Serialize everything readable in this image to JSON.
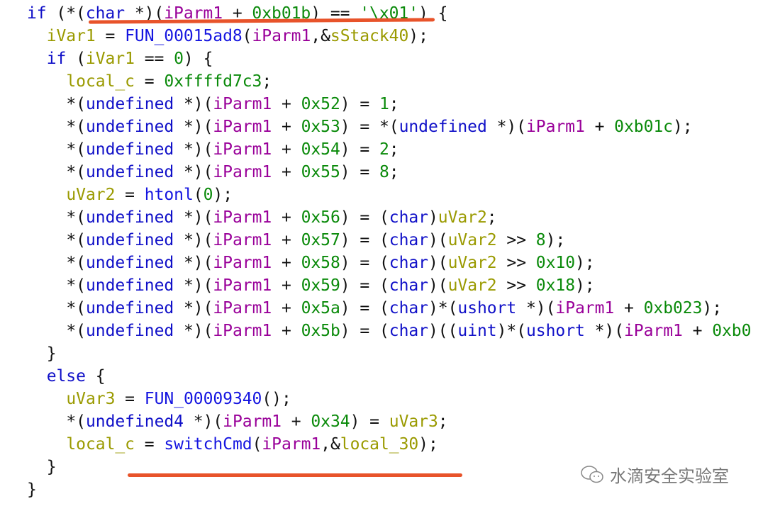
{
  "code_lines": [
    {
      "indent": 0,
      "tokens": [
        [
          "if",
          "kw"
        ],
        [
          " (*(",
          "op"
        ],
        [
          "char",
          "kw"
        ],
        [
          " *)(",
          "op"
        ],
        [
          "iParm1",
          "pa"
        ],
        [
          " + ",
          "op"
        ],
        [
          "0xb01b",
          "nu"
        ],
        [
          ") == ",
          "op"
        ],
        [
          "'\\x01'",
          "nu"
        ],
        [
          ") {",
          "op"
        ]
      ]
    },
    {
      "indent": 1,
      "tokens": [
        [
          "iVar1",
          "va"
        ],
        [
          " = ",
          "op"
        ],
        [
          "FUN_00015ad8",
          "fn"
        ],
        [
          "(",
          "op"
        ],
        [
          "iParm1",
          "pa"
        ],
        [
          ",&",
          "op"
        ],
        [
          "sStack40",
          "va"
        ],
        [
          ");",
          "op"
        ]
      ]
    },
    {
      "indent": 1,
      "tokens": [
        [
          "if",
          "kw"
        ],
        [
          " (",
          "op"
        ],
        [
          "iVar1",
          "va"
        ],
        [
          " == ",
          "op"
        ],
        [
          "0",
          "nu"
        ],
        [
          ") {",
          "op"
        ]
      ]
    },
    {
      "indent": 2,
      "tokens": [
        [
          "local_c",
          "va"
        ],
        [
          " = ",
          "op"
        ],
        [
          "0xffffd7c3",
          "nu"
        ],
        [
          ";",
          "op"
        ]
      ]
    },
    {
      "indent": 2,
      "tokens": [
        [
          "*(",
          "op"
        ],
        [
          "undefined",
          "kw"
        ],
        [
          " *)(",
          "op"
        ],
        [
          "iParm1",
          "pa"
        ],
        [
          " + ",
          "op"
        ],
        [
          "0x52",
          "nu"
        ],
        [
          ") = ",
          "op"
        ],
        [
          "1",
          "nu"
        ],
        [
          ";",
          "op"
        ]
      ]
    },
    {
      "indent": 2,
      "tokens": [
        [
          "*(",
          "op"
        ],
        [
          "undefined",
          "kw"
        ],
        [
          " *)(",
          "op"
        ],
        [
          "iParm1",
          "pa"
        ],
        [
          " + ",
          "op"
        ],
        [
          "0x53",
          "nu"
        ],
        [
          ") = *(",
          "op"
        ],
        [
          "undefined",
          "kw"
        ],
        [
          " *)(",
          "op"
        ],
        [
          "iParm1",
          "pa"
        ],
        [
          " + ",
          "op"
        ],
        [
          "0xb01c",
          "nu"
        ],
        [
          ");",
          "op"
        ]
      ]
    },
    {
      "indent": 2,
      "tokens": [
        [
          "*(",
          "op"
        ],
        [
          "undefined",
          "kw"
        ],
        [
          " *)(",
          "op"
        ],
        [
          "iParm1",
          "pa"
        ],
        [
          " + ",
          "op"
        ],
        [
          "0x54",
          "nu"
        ],
        [
          ") = ",
          "op"
        ],
        [
          "2",
          "nu"
        ],
        [
          ";",
          "op"
        ]
      ]
    },
    {
      "indent": 2,
      "tokens": [
        [
          "*(",
          "op"
        ],
        [
          "undefined",
          "kw"
        ],
        [
          " *)(",
          "op"
        ],
        [
          "iParm1",
          "pa"
        ],
        [
          " + ",
          "op"
        ],
        [
          "0x55",
          "nu"
        ],
        [
          ") = ",
          "op"
        ],
        [
          "8",
          "nu"
        ],
        [
          ";",
          "op"
        ]
      ]
    },
    {
      "indent": 2,
      "tokens": [
        [
          "uVar2",
          "va"
        ],
        [
          " = ",
          "op"
        ],
        [
          "htonl",
          "fn"
        ],
        [
          "(",
          "op"
        ],
        [
          "0",
          "nu"
        ],
        [
          ");",
          "op"
        ]
      ]
    },
    {
      "indent": 2,
      "tokens": [
        [
          "*(",
          "op"
        ],
        [
          "undefined",
          "kw"
        ],
        [
          " *)(",
          "op"
        ],
        [
          "iParm1",
          "pa"
        ],
        [
          " + ",
          "op"
        ],
        [
          "0x56",
          "nu"
        ],
        [
          ") = (",
          "op"
        ],
        [
          "char",
          "kw"
        ],
        [
          ")",
          "op"
        ],
        [
          "uVar2",
          "va"
        ],
        [
          ";",
          "op"
        ]
      ]
    },
    {
      "indent": 2,
      "tokens": [
        [
          "*(",
          "op"
        ],
        [
          "undefined",
          "kw"
        ],
        [
          " *)(",
          "op"
        ],
        [
          "iParm1",
          "pa"
        ],
        [
          " + ",
          "op"
        ],
        [
          "0x57",
          "nu"
        ],
        [
          ") = (",
          "op"
        ],
        [
          "char",
          "kw"
        ],
        [
          ")(",
          "op"
        ],
        [
          "uVar2",
          "va"
        ],
        [
          " >> ",
          "op"
        ],
        [
          "8",
          "nu"
        ],
        [
          ");",
          "op"
        ]
      ]
    },
    {
      "indent": 2,
      "tokens": [
        [
          "*(",
          "op"
        ],
        [
          "undefined",
          "kw"
        ],
        [
          " *)(",
          "op"
        ],
        [
          "iParm1",
          "pa"
        ],
        [
          " + ",
          "op"
        ],
        [
          "0x58",
          "nu"
        ],
        [
          ") = (",
          "op"
        ],
        [
          "char",
          "kw"
        ],
        [
          ")(",
          "op"
        ],
        [
          "uVar2",
          "va"
        ],
        [
          " >> ",
          "op"
        ],
        [
          "0x10",
          "nu"
        ],
        [
          ");",
          "op"
        ]
      ]
    },
    {
      "indent": 2,
      "tokens": [
        [
          "*(",
          "op"
        ],
        [
          "undefined",
          "kw"
        ],
        [
          " *)(",
          "op"
        ],
        [
          "iParm1",
          "pa"
        ],
        [
          " + ",
          "op"
        ],
        [
          "0x59",
          "nu"
        ],
        [
          ") = (",
          "op"
        ],
        [
          "char",
          "kw"
        ],
        [
          ")(",
          "op"
        ],
        [
          "uVar2",
          "va"
        ],
        [
          " >> ",
          "op"
        ],
        [
          "0x18",
          "nu"
        ],
        [
          ");",
          "op"
        ]
      ]
    },
    {
      "indent": 2,
      "tokens": [
        [
          "*(",
          "op"
        ],
        [
          "undefined",
          "kw"
        ],
        [
          " *)(",
          "op"
        ],
        [
          "iParm1",
          "pa"
        ],
        [
          " + ",
          "op"
        ],
        [
          "0x5a",
          "nu"
        ],
        [
          ") = (",
          "op"
        ],
        [
          "char",
          "kw"
        ],
        [
          ")*(",
          "op"
        ],
        [
          "ushort",
          "kw"
        ],
        [
          " *)(",
          "op"
        ],
        [
          "iParm1",
          "pa"
        ],
        [
          " + ",
          "op"
        ],
        [
          "0xb023",
          "nu"
        ],
        [
          ");",
          "op"
        ]
      ]
    },
    {
      "indent": 2,
      "tokens": [
        [
          "*(",
          "op"
        ],
        [
          "undefined",
          "kw"
        ],
        [
          " *)(",
          "op"
        ],
        [
          "iParm1",
          "pa"
        ],
        [
          " + ",
          "op"
        ],
        [
          "0x5b",
          "nu"
        ],
        [
          ") = (",
          "op"
        ],
        [
          "char",
          "kw"
        ],
        [
          ")((",
          "op"
        ],
        [
          "uint",
          "kw"
        ],
        [
          ")*(",
          "op"
        ],
        [
          "ushort",
          "kw"
        ],
        [
          " *)(",
          "op"
        ],
        [
          "iParm1",
          "pa"
        ],
        [
          " + ",
          "op"
        ],
        [
          "0xb0",
          "nu"
        ]
      ]
    },
    {
      "indent": 1,
      "tokens": [
        [
          "}",
          "op"
        ]
      ]
    },
    {
      "indent": 1,
      "tokens": [
        [
          "else",
          "kw"
        ],
        [
          " {",
          "op"
        ]
      ]
    },
    {
      "indent": 2,
      "tokens": [
        [
          "uVar3",
          "va"
        ],
        [
          " = ",
          "op"
        ],
        [
          "FUN_00009340",
          "fn"
        ],
        [
          "();",
          "op"
        ]
      ]
    },
    {
      "indent": 2,
      "tokens": [
        [
          "*(",
          "op"
        ],
        [
          "undefined4",
          "kw"
        ],
        [
          " *)(",
          "op"
        ],
        [
          "iParm1",
          "pa"
        ],
        [
          " + ",
          "op"
        ],
        [
          "0x34",
          "nu"
        ],
        [
          ") = ",
          "op"
        ],
        [
          "uVar3",
          "va"
        ],
        [
          ";",
          "op"
        ]
      ]
    },
    {
      "indent": 2,
      "tokens": [
        [
          "local_c",
          "va"
        ],
        [
          " = ",
          "op"
        ],
        [
          "switchCmd",
          "fn"
        ],
        [
          "(",
          "op"
        ],
        [
          "iParm1",
          "pa"
        ],
        [
          ",&",
          "op"
        ],
        [
          "local_30",
          "va"
        ],
        [
          ");",
          "op"
        ]
      ]
    },
    {
      "indent": 1,
      "tokens": [
        [
          "}",
          "op"
        ]
      ]
    },
    {
      "indent": 0,
      "tokens": [
        [
          "}",
          "op"
        ]
      ]
    }
  ],
  "watermark": {
    "text": "水滴安全实验室",
    "icon": "wechat-icon"
  },
  "colors": {
    "annotation": "#e8532a",
    "keyword": "#1010c8",
    "param": "#990099",
    "variable": "#9a9a00",
    "number": "#0a8a0a"
  }
}
